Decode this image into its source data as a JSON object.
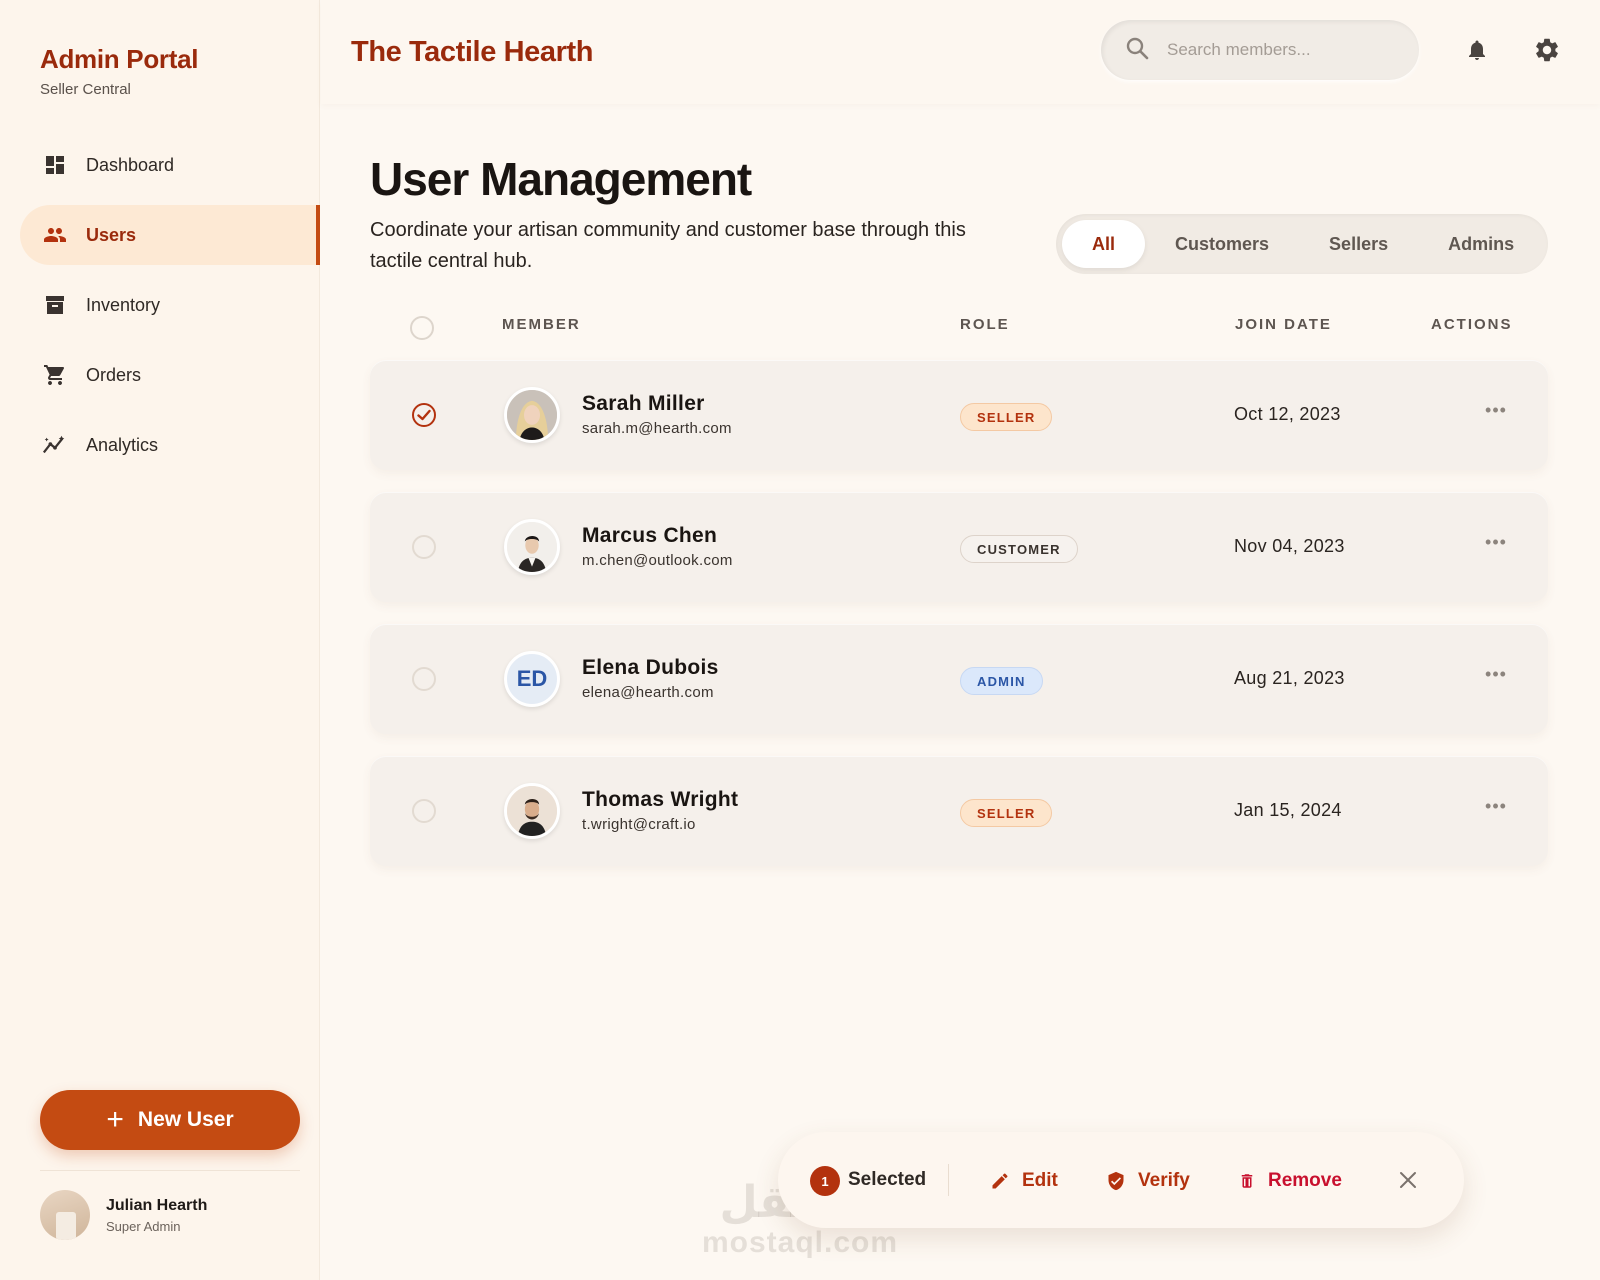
{
  "sidebar": {
    "brand_title": "Admin Portal",
    "brand_subtitle": "Seller Central",
    "items": [
      {
        "label": "Dashboard",
        "icon": "dashboard-icon",
        "active": false
      },
      {
        "label": "Users",
        "icon": "users-icon",
        "active": true
      },
      {
        "label": "Inventory",
        "icon": "archive-icon",
        "active": false
      },
      {
        "label": "Orders",
        "icon": "cart-icon",
        "active": false
      },
      {
        "label": "Analytics",
        "icon": "analytics-icon",
        "active": false
      }
    ],
    "new_user_label": "New User",
    "profile": {
      "name": "Julian Hearth",
      "role": "Super Admin"
    }
  },
  "header": {
    "site_title": "The Tactile Hearth",
    "search_placeholder": "Search members..."
  },
  "page": {
    "title": "User Management",
    "description": "Coordinate your artisan community and customer base through this tactile central hub.",
    "tabs": [
      {
        "label": "All",
        "active": true
      },
      {
        "label": "Customers",
        "active": false
      },
      {
        "label": "Sellers",
        "active": false
      },
      {
        "label": "Admins",
        "active": false
      }
    ]
  },
  "table": {
    "columns": [
      "MEMBER",
      "ROLE",
      "JOIN DATE",
      "ACTIONS"
    ],
    "rows": [
      {
        "name": "Sarah Miller",
        "email": "sarah.m@hearth.com",
        "role": "SELLER",
        "join_date": "Oct 12, 2023",
        "selected": true,
        "avatar": "photo"
      },
      {
        "name": "Marcus Chen",
        "email": "m.chen@outlook.com",
        "role": "CUSTOMER",
        "join_date": "Nov 04, 2023",
        "selected": false,
        "avatar": "photo"
      },
      {
        "name": "Elena Dubois",
        "email": "elena@hearth.com",
        "role": "ADMIN",
        "join_date": "Aug 21, 2023",
        "selected": false,
        "avatar": "ED"
      },
      {
        "name": "Thomas Wright",
        "email": "t.wright@craft.io",
        "role": "SELLER",
        "join_date": "Jan 15, 2024",
        "selected": false,
        "avatar": "photo"
      }
    ]
  },
  "selection_bar": {
    "count": "1",
    "label": "Selected",
    "edit": "Edit",
    "verify": "Verify",
    "remove": "Remove"
  },
  "watermark": {
    "arabic": "مستقل",
    "latin": "mostaql.com"
  },
  "colors": {
    "accent": "#9a2a0c",
    "button": "#c44b12",
    "background": "#fdf8f2"
  }
}
